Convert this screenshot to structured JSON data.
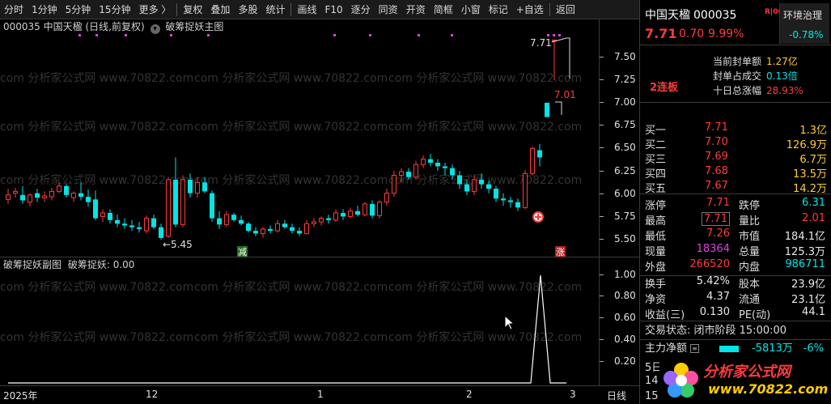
{
  "toolbar": {
    "items": [
      "分时",
      "1分钟",
      "5分钟",
      "15分钟",
      "更多 〉",
      "复权",
      "叠加",
      "多股",
      "统计",
      "画线",
      "F10",
      "逐分",
      "同资",
      "开资",
      "简框",
      "小窗",
      "标记",
      "+自选",
      "返回"
    ]
  },
  "main_chart": {
    "code": "000035",
    "name": "中国天楹",
    "period": "(日线,前复权)",
    "indicator": "破筹捉妖主图",
    "price_ticks": [
      "7.50",
      "7.25",
      "7.00",
      "6.75",
      "6.50",
      "6.25",
      "6.00",
      "5.75",
      "5.50"
    ],
    "high_label": "7.71",
    "prev_label": "7.01",
    "low_label": "5.45",
    "low_arrow": "←",
    "marker_reduce": "减",
    "marker_rise": "涨"
  },
  "sub_chart": {
    "title": "破筹捉妖副图",
    "value_label": "破筹捉妖: 0.00",
    "ticks": [
      "1.00",
      "0.80",
      "0.60",
      "0.40",
      "0.20"
    ]
  },
  "date_axis": {
    "labels": [
      "2025年",
      "12",
      "1",
      "2",
      "3"
    ],
    "period_button": "日线"
  },
  "watermark": "com 分析家公式网 www.70822.com",
  "quote": {
    "name": "中国天楹",
    "code": "000035",
    "flag": "R|000",
    "price": "7.71",
    "change": "0.70",
    "change_pct": "9.99%",
    "sector_name": "环境治理",
    "sector_chg": "-0.78%"
  },
  "limit_info": {
    "streak": "2连板",
    "rows": [
      {
        "k": "当前封单额",
        "v": "1.27亿",
        "c": "yellow"
      },
      {
        "k": "封单占成交",
        "v": "0.13倍",
        "c": "cyan"
      },
      {
        "k": "十日总涨幅",
        "v": "28.93%",
        "c": "red"
      }
    ]
  },
  "order_book": [
    {
      "label": "买一",
      "price": "7.71",
      "vol": "1.3亿"
    },
    {
      "label": "买二",
      "price": "7.70",
      "vol": "126.9万"
    },
    {
      "label": "买三",
      "price": "7.69",
      "vol": "6.7万"
    },
    {
      "label": "买四",
      "price": "7.68",
      "vol": "13.5万"
    },
    {
      "label": "买五",
      "price": "7.67",
      "vol": "14.2万"
    }
  ],
  "stats": [
    {
      "k1": "涨停",
      "v1": "7.71",
      "c1": "red",
      "k2": "跌停",
      "v2": "6.31",
      "c2": "cyan"
    },
    {
      "k1": "最高",
      "v1": "7.71",
      "c1": "red",
      "k2": "量比",
      "v2": "2.01",
      "c2": "red"
    },
    {
      "k1": "最低",
      "v1": "7.26",
      "c1": "red",
      "k2": "市值",
      "v2": "184.1亿",
      "c2": "white"
    },
    {
      "k1": "现量",
      "v1": "18364",
      "c1": "mag",
      "k2": "总量",
      "v2": "125.3万",
      "c2": "white"
    },
    {
      "k1": "外盘",
      "v1": "266520",
      "c1": "red",
      "k2": "内盘",
      "v2": "986711",
      "c2": "cyan"
    }
  ],
  "fundamentals": [
    {
      "k1": "换手",
      "v1": "5.42%",
      "k2": "股本",
      "v2": "23.9亿"
    },
    {
      "k1": "净资",
      "v1": "4.37",
      "k2": "流通",
      "v2": "23.1亿"
    },
    {
      "k1": "收益(三)",
      "v1": "0.130",
      "k2": "PE(动)",
      "v2": "44.1"
    }
  ],
  "trade_status": "交易状态: 闭市阶段 15:00:00",
  "main_flow": {
    "label": "主力净额",
    "value": "-5813万",
    "pct": "-6%"
  },
  "tail_rows": [
    "5日",
    "14:",
    "15:"
  ],
  "logo": {
    "text": "分析家公式网",
    "url": "www.70822.com"
  },
  "colors": {
    "up": "#ff3b3b",
    "down": "#00e5e5",
    "limit_dot": "#e040e0"
  },
  "chart_data": {
    "type": "candlestick",
    "ylim": [
      5.4,
      7.75
    ],
    "candles": [
      {
        "o": 5.93,
        "h": 6.05,
        "l": 5.88,
        "c": 5.98
      },
      {
        "o": 6.0,
        "h": 6.06,
        "l": 5.95,
        "c": 6.02
      },
      {
        "o": 5.98,
        "h": 6.08,
        "l": 5.88,
        "c": 5.92
      },
      {
        "o": 5.9,
        "h": 6.0,
        "l": 5.85,
        "c": 5.98
      },
      {
        "o": 6.0,
        "h": 6.05,
        "l": 5.9,
        "c": 5.95
      },
      {
        "o": 5.95,
        "h": 6.02,
        "l": 5.9,
        "c": 5.97
      },
      {
        "o": 5.96,
        "h": 6.06,
        "l": 5.92,
        "c": 6.02
      },
      {
        "o": 6.02,
        "h": 6.12,
        "l": 6.0,
        "c": 6.08
      },
      {
        "o": 6.08,
        "h": 6.1,
        "l": 5.95,
        "c": 5.98
      },
      {
        "o": 5.95,
        "h": 6.02,
        "l": 5.9,
        "c": 6.0
      },
      {
        "o": 6.0,
        "h": 6.12,
        "l": 5.92,
        "c": 5.96
      },
      {
        "o": 5.96,
        "h": 6.04,
        "l": 5.85,
        "c": 5.9
      },
      {
        "o": 5.93,
        "h": 6.03,
        "l": 5.7,
        "c": 5.72
      },
      {
        "o": 5.74,
        "h": 5.82,
        "l": 5.68,
        "c": 5.78
      },
      {
        "o": 5.78,
        "h": 5.82,
        "l": 5.66,
        "c": 5.7
      },
      {
        "o": 5.7,
        "h": 5.76,
        "l": 5.62,
        "c": 5.66
      },
      {
        "o": 5.66,
        "h": 5.72,
        "l": 5.6,
        "c": 5.64
      },
      {
        "o": 5.64,
        "h": 5.7,
        "l": 5.58,
        "c": 5.62
      },
      {
        "o": 5.62,
        "h": 5.68,
        "l": 5.56,
        "c": 5.6
      },
      {
        "o": 5.58,
        "h": 5.75,
        "l": 5.55,
        "c": 5.72
      },
      {
        "o": 5.72,
        "h": 5.76,
        "l": 5.6,
        "c": 5.62
      },
      {
        "o": 5.62,
        "h": 5.66,
        "l": 5.48,
        "c": 5.5
      },
      {
        "o": 5.52,
        "h": 6.18,
        "l": 5.5,
        "c": 6.15
      },
      {
        "o": 6.15,
        "h": 6.4,
        "l": 5.62,
        "c": 5.65
      },
      {
        "o": 5.65,
        "h": 6.2,
        "l": 5.62,
        "c": 6.15
      },
      {
        "o": 6.15,
        "h": 6.22,
        "l": 5.95,
        "c": 6.0
      },
      {
        "o": 6.0,
        "h": 6.18,
        "l": 5.95,
        "c": 6.12
      },
      {
        "o": 6.12,
        "h": 6.18,
        "l": 6.0,
        "c": 6.02
      },
      {
        "o": 6.0,
        "h": 6.03,
        "l": 5.68,
        "c": 5.72
      },
      {
        "o": 5.72,
        "h": 5.8,
        "l": 5.6,
        "c": 5.65
      },
      {
        "o": 5.65,
        "h": 5.8,
        "l": 5.62,
        "c": 5.76
      },
      {
        "o": 5.76,
        "h": 5.78,
        "l": 5.68,
        "c": 5.7
      },
      {
        "o": 5.7,
        "h": 5.75,
        "l": 5.64,
        "c": 5.66
      },
      {
        "o": 5.66,
        "h": 5.68,
        "l": 5.56,
        "c": 5.58
      },
      {
        "o": 5.58,
        "h": 5.62,
        "l": 5.52,
        "c": 5.55
      },
      {
        "o": 5.55,
        "h": 5.62,
        "l": 5.5,
        "c": 5.6
      },
      {
        "o": 5.6,
        "h": 5.64,
        "l": 5.55,
        "c": 5.58
      },
      {
        "o": 5.58,
        "h": 5.7,
        "l": 5.56,
        "c": 5.66
      },
      {
        "o": 5.66,
        "h": 5.7,
        "l": 5.6,
        "c": 5.62
      },
      {
        "o": 5.62,
        "h": 5.66,
        "l": 5.55,
        "c": 5.58
      },
      {
        "o": 5.58,
        "h": 5.62,
        "l": 5.52,
        "c": 5.55
      },
      {
        "o": 5.55,
        "h": 5.7,
        "l": 5.54,
        "c": 5.66
      },
      {
        "o": 5.66,
        "h": 5.72,
        "l": 5.62,
        "c": 5.68
      },
      {
        "o": 5.68,
        "h": 5.74,
        "l": 5.64,
        "c": 5.72
      },
      {
        "o": 5.72,
        "h": 5.76,
        "l": 5.66,
        "c": 5.7
      },
      {
        "o": 5.7,
        "h": 5.82,
        "l": 5.68,
        "c": 5.78
      },
      {
        "o": 5.78,
        "h": 5.82,
        "l": 5.7,
        "c": 5.74
      },
      {
        "o": 5.74,
        "h": 5.84,
        "l": 5.72,
        "c": 5.8
      },
      {
        "o": 5.8,
        "h": 5.86,
        "l": 5.74,
        "c": 5.76
      },
      {
        "o": 5.76,
        "h": 5.9,
        "l": 5.74,
        "c": 5.88
      },
      {
        "o": 5.88,
        "h": 5.92,
        "l": 5.72,
        "c": 5.75
      },
      {
        "o": 5.75,
        "h": 5.92,
        "l": 5.72,
        "c": 5.9
      },
      {
        "o": 5.9,
        "h": 6.05,
        "l": 5.86,
        "c": 6.0
      },
      {
        "o": 6.0,
        "h": 6.25,
        "l": 5.96,
        "c": 6.2
      },
      {
        "o": 6.2,
        "h": 6.28,
        "l": 6.12,
        "c": 6.24
      },
      {
        "o": 6.24,
        "h": 6.28,
        "l": 6.15,
        "c": 6.18
      },
      {
        "o": 6.18,
        "h": 6.36,
        "l": 6.15,
        "c": 6.32
      },
      {
        "o": 6.32,
        "h": 6.42,
        "l": 6.28,
        "c": 6.38
      },
      {
        "o": 6.38,
        "h": 6.44,
        "l": 6.3,
        "c": 6.34
      },
      {
        "o": 6.34,
        "h": 6.38,
        "l": 6.25,
        "c": 6.3
      },
      {
        "o": 6.3,
        "h": 6.34,
        "l": 6.2,
        "c": 6.28
      },
      {
        "o": 6.28,
        "h": 6.32,
        "l": 6.15,
        "c": 6.2
      },
      {
        "o": 6.2,
        "h": 6.25,
        "l": 6.05,
        "c": 6.1
      },
      {
        "o": 6.1,
        "h": 6.15,
        "l": 5.98,
        "c": 6.02
      },
      {
        "o": 6.02,
        "h": 6.2,
        "l": 5.98,
        "c": 6.15
      },
      {
        "o": 6.15,
        "h": 6.22,
        "l": 6.05,
        "c": 6.1
      },
      {
        "o": 6.1,
        "h": 6.14,
        "l": 6.0,
        "c": 6.05
      },
      {
        "o": 6.05,
        "h": 6.08,
        "l": 5.9,
        "c": 5.94
      },
      {
        "o": 5.94,
        "h": 6.0,
        "l": 5.86,
        "c": 5.92
      },
      {
        "o": 5.92,
        "h": 5.96,
        "l": 5.84,
        "c": 5.9
      },
      {
        "o": 5.9,
        "h": 5.94,
        "l": 5.8,
        "c": 5.84
      },
      {
        "o": 5.84,
        "h": 6.26,
        "l": 5.82,
        "c": 6.22
      },
      {
        "o": 6.22,
        "h": 6.52,
        "l": 6.2,
        "c": 6.5
      },
      {
        "o": 6.48,
        "h": 6.55,
        "l": 6.3,
        "c": 6.4
      },
      {
        "o": 7.01,
        "h": 7.01,
        "l": 6.85,
        "c": 6.85
      },
      {
        "o": 7.71,
        "h": 7.71,
        "l": 7.26,
        "c": 7.71
      }
    ],
    "sub_series": {
      "name": "破筹捉妖",
      "values_tail": [
        0,
        0,
        1,
        0
      ]
    }
  }
}
